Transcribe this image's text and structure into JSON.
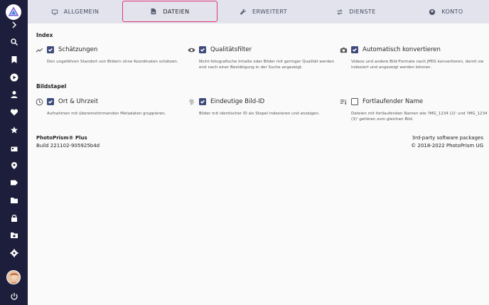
{
  "tabs": [
    {
      "label": "ALLGEMEIN",
      "icon": "monitor-icon"
    },
    {
      "label": "DATEIEN",
      "icon": "folder-image-icon"
    },
    {
      "label": "ERWEITERT",
      "icon": "wrench-icon"
    },
    {
      "label": "DIENSTE",
      "icon": "swap-icon"
    },
    {
      "label": "KONTO",
      "icon": "account-icon"
    }
  ],
  "sections": {
    "index": "Index",
    "stack": "Bildstapel"
  },
  "options": {
    "estimates": {
      "label": "Schätzungen",
      "desc": "Den ungefähren Standort von Bildern ohne Koordinaten schätzen.",
      "checked": true
    },
    "quality": {
      "label": "Qualitätsfilter",
      "desc": "Nicht-fotografische Inhalte oder Bilder mit geringer Qualität werden erst nach einer Bestätigung in der Suche angezeigt.",
      "checked": true
    },
    "convert": {
      "label": "Automatisch konvertieren",
      "desc": "Videos und andere Bild-Formate nach JPEG konvertieren, damit sie indexiert und angezeigt werden können.",
      "checked": true
    },
    "place_time": {
      "label": "Ort & Uhrzeit",
      "desc": "Aufnahmen mit übereinstimmenden Metadaten gruppieren.",
      "checked": true
    },
    "unique_id": {
      "label": "Eindeutige Bild-ID",
      "desc": "Bilder mit identischer ID als Stapel indexieren und anzeigen.",
      "checked": true
    },
    "seq_name": {
      "label": "Fortlaufender Name",
      "desc": "Dateien mit fortlaufenden Namen wie 'IMG_1234 (2)' und 'IMG_1234 (3)' gehören zum gleichen Bild.",
      "checked": false
    }
  },
  "footer": {
    "product": "PhotoPrism® Plus",
    "build": "Build 221102-905925b4d",
    "packages": "3rd-party software packages",
    "copyright": "© 2018-2022 PhotoPrism UG"
  },
  "colors": {
    "sidebar": "#1d1e3b",
    "tabbar": "#e2e3ed",
    "active_tab_border": "#e0367c",
    "checkbox": "#3d4a7a"
  }
}
